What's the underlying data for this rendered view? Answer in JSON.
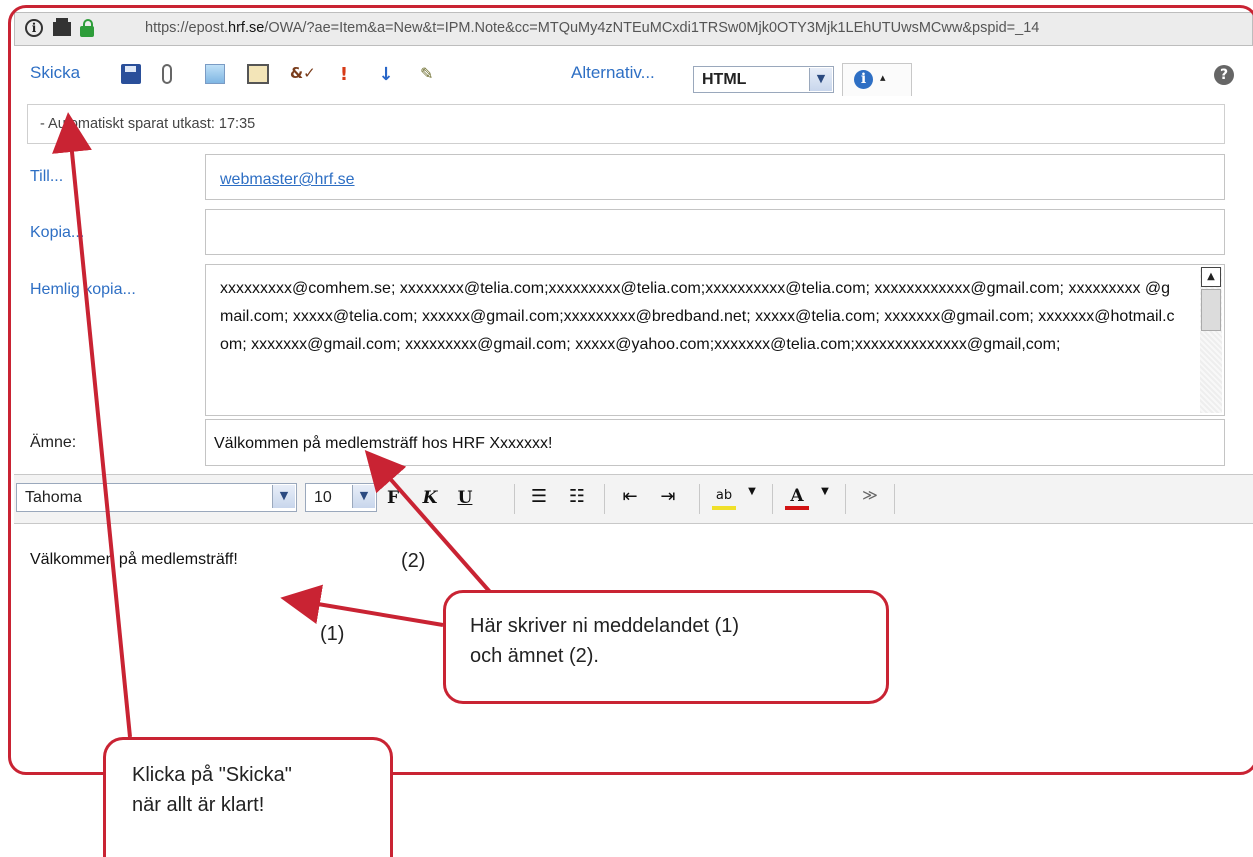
{
  "address_bar": {
    "url_prefix": "https://epost.",
    "url_domain": "hrf.se",
    "url_rest": "/OWA/?ae=Item&a=New&t=IPM.Note&cc=MTQuMy4zNTEuMCxdi1TRSw0Mjk0OTY3Mjk1LEhUTUwsMCww&pspid=_14"
  },
  "toolbar": {
    "send_label": "Skicka",
    "options_label": "Alternativ...",
    "format_value": "HTML",
    "icons": [
      "save-icon",
      "attach-icon",
      "image-icon",
      "address-book-icon",
      "spellcheck-icon",
      "high-importance-icon",
      "low-importance-icon",
      "signature-icon",
      "info-icon",
      "help-icon"
    ]
  },
  "draft": {
    "text": "- Automatiskt sparat utkast: 17:35"
  },
  "fields": {
    "to_label": "Till...",
    "to_value": "webmaster@hrf.se",
    "cc_label": "Kopia...",
    "cc_value": "",
    "bcc_label": "Hemlig kopia...",
    "bcc_value": "xxxxxxxxx@comhem.se; xxxxxxxx@telia.com;xxxxxxxxx@telia.com;xxxxxxxxxx@telia.com; xxxxxxxxxxxx@gmail.com; xxxxxxxxx @gmail.com; xxxxx@telia.com; xxxxxx@gmail.com;xxxxxxxxx@bredband.net; xxxxx@telia.com; xxxxxxx@gmail.com; xxxxxxx@hotmail.com; xxxxxxx@gmail.com; xxxxxxxxx@gmail.com; xxxxx@yahoo.com;xxxxxxx@telia.com;xxxxxxxxxxxxxx@gmail,com;",
    "subject_label": "Ämne:",
    "subject_value": "Välkommen på medlemsträff hos HRF Xxxxxxx!"
  },
  "format_bar": {
    "font_value": "Tahoma",
    "size_value": "10",
    "bold": "F",
    "italic": "K",
    "underline": "U"
  },
  "message": {
    "body": "Välkommen på medlemsträff!"
  },
  "annotations": {
    "marker_2": "(2)",
    "marker_1": "(1)",
    "callout_message_line1": "Här skriver ni meddelandet (1)",
    "callout_message_line2": "och ämnet (2).",
    "callout_send_line1": "Klicka på \"Skicka\"",
    "callout_send_line2": "när allt är klart!",
    "accent_color": "#c92333"
  }
}
